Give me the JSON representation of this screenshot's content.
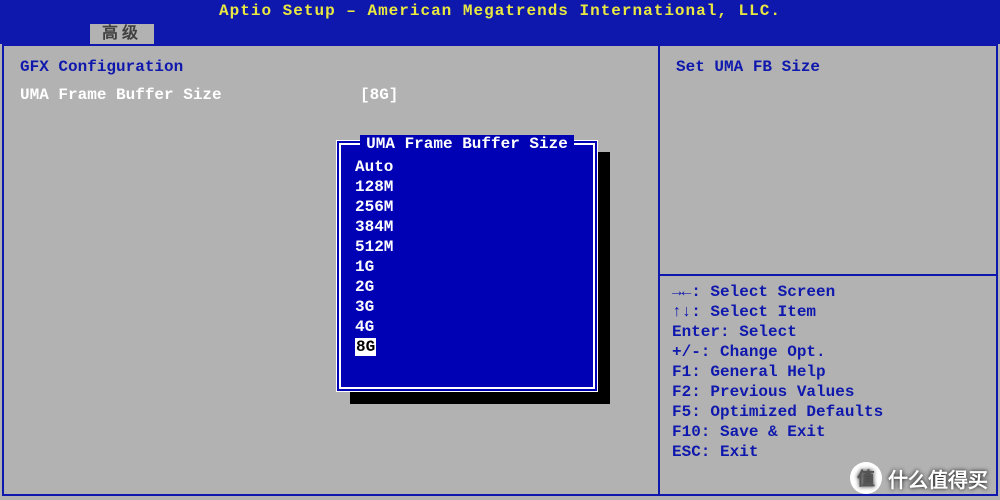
{
  "header": {
    "title": "Aptio Setup – American Megatrends International, LLC."
  },
  "tabs": {
    "active": "高级"
  },
  "main": {
    "section_title": "GFX Configuration",
    "setting_label": "UMA Frame Buffer Size",
    "setting_value": "[8G]"
  },
  "side": {
    "help_title": "Set UMA FB Size",
    "keyhelp": [
      "→←: Select Screen",
      "↑↓: Select Item",
      "Enter: Select",
      "+/-: Change Opt.",
      "F1: General Help",
      "F2: Previous Values",
      "F5: Optimized Defaults",
      "F10: Save & Exit",
      "ESC: Exit"
    ]
  },
  "popup": {
    "title": "UMA Frame Buffer Size",
    "options": [
      "Auto",
      "128M",
      "256M",
      "384M",
      "512M",
      "1G",
      "2G",
      "3G",
      "4G",
      "8G"
    ],
    "selected": "8G"
  },
  "watermark": {
    "badge": "值",
    "text": "什么值得买"
  }
}
